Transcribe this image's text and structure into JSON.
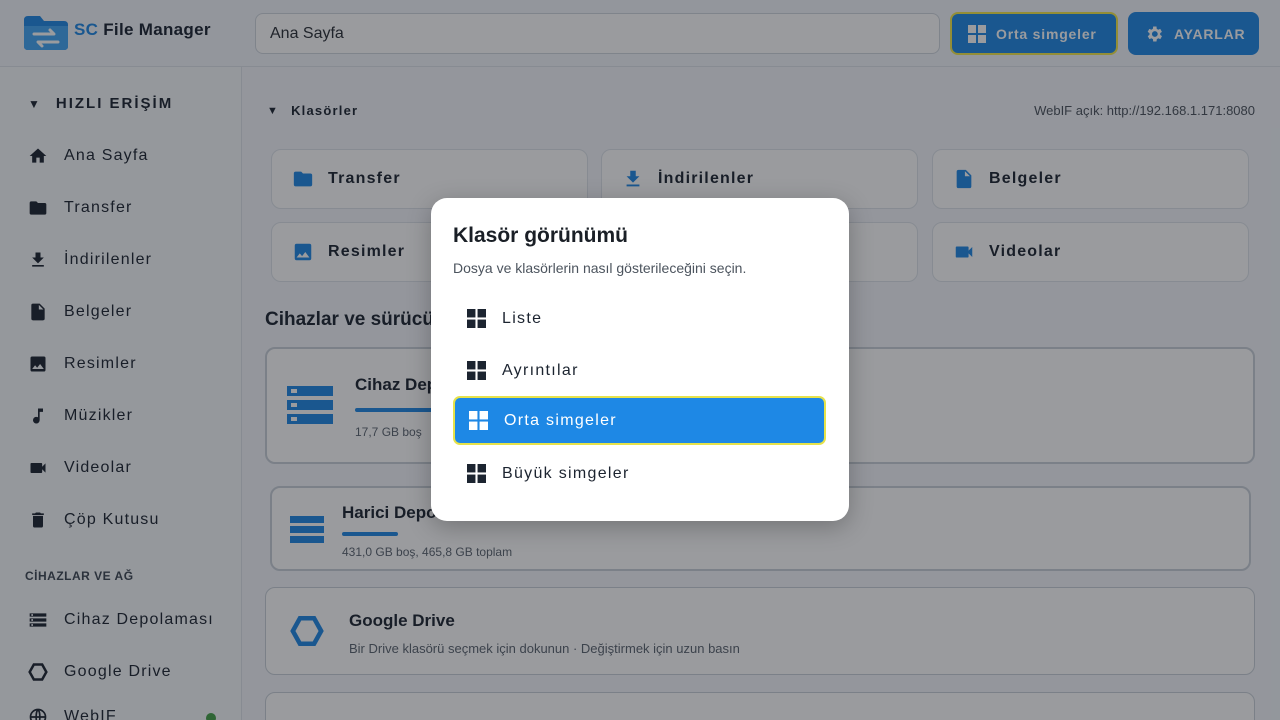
{
  "app": {
    "title_prefix": "SC",
    "title_rest": " File Manager"
  },
  "header": {
    "path": "Ana Sayfa",
    "view_button": "Orta simgeler",
    "settings_button": "AYARLAR"
  },
  "sidebar": {
    "quick_access": "HIZLI ERİŞİM",
    "items": [
      {
        "label": "Ana Sayfa",
        "icon": "home-icon"
      },
      {
        "label": "Transfer",
        "icon": "folder-icon"
      },
      {
        "label": "İndirilenler",
        "icon": "download-icon"
      },
      {
        "label": "Belgeler",
        "icon": "document-icon"
      },
      {
        "label": "Resimler",
        "icon": "image-icon"
      },
      {
        "label": "Müzikler",
        "icon": "music-icon"
      },
      {
        "label": "Videolar",
        "icon": "video-icon"
      },
      {
        "label": "Çöp Kutusu",
        "icon": "trash-icon"
      }
    ],
    "devices_section": "CİHAZLAR VE AĞ",
    "devices": [
      {
        "label": "Cihaz Depolaması",
        "icon": "storage-icon"
      },
      {
        "label": "Google Drive",
        "icon": "drive-icon"
      },
      {
        "label": "WebIF",
        "icon": "globe-icon"
      }
    ]
  },
  "main": {
    "folders_label": "Klasörler",
    "webif_status": "WebIF açık: http://192.168.1.171:8080",
    "folders": [
      {
        "label": "Transfer",
        "icon": "folder-icon"
      },
      {
        "label": "İndirilenler",
        "icon": "download-icon"
      },
      {
        "label": "Belgeler",
        "icon": "document-icon"
      },
      {
        "label": "Resimler",
        "icon": "image-icon"
      },
      {
        "label": "",
        "icon": ""
      },
      {
        "label": "Videolar",
        "icon": "video-icon"
      }
    ],
    "devices_title": "Cihazlar ve sürücü",
    "devices": [
      {
        "title": "Cihaz Depo",
        "sub": "17,7 GB boş"
      },
      {
        "title": "Harici Depo",
        "sub": "431,0 GB boş, 465,8 GB toplam"
      },
      {
        "title": "Google Drive",
        "sub": "Bir Drive klasörü seçmek için dokunun · Değiştirmek için uzun basın"
      }
    ]
  },
  "dialog": {
    "title": "Klasör görünümü",
    "subtitle": "Dosya ve klasörlerin nasıl gösterileceğini seçin.",
    "options": [
      "Liste",
      "Ayrıntılar",
      "Orta simgeler",
      "Büyük simgeler"
    ],
    "selected_index": 2
  },
  "colors": {
    "accent": "#1e88e5",
    "focus_ring": "#e6e24a",
    "overlay": "rgba(20,24,30,0.43)"
  }
}
